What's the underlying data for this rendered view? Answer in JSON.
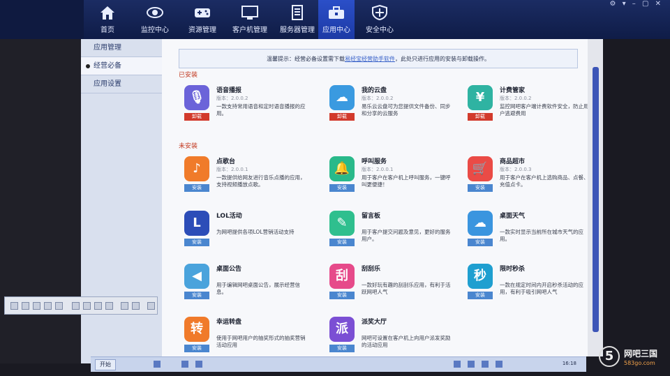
{
  "nav": {
    "items": [
      {
        "label": "首页",
        "icon": "home-icon"
      },
      {
        "label": "监控中心",
        "icon": "eye-icon"
      },
      {
        "label": "资源管理",
        "icon": "gamepad-icon"
      },
      {
        "label": "客户机管理",
        "icon": "monitor-icon"
      },
      {
        "label": "服务器管理",
        "icon": "server-icon"
      },
      {
        "label": "应用中心",
        "icon": "toolbox-icon"
      },
      {
        "label": "安全中心",
        "icon": "shield-icon"
      }
    ],
    "active": "应用中心"
  },
  "sidebar": {
    "items": [
      {
        "label": "应用管理"
      },
      {
        "label": "经营必备"
      },
      {
        "label": "应用设置"
      }
    ]
  },
  "tip": {
    "prefix": "温馨提示：经营必备设置需下载",
    "link": "易经宝经营助手软件",
    "suffix": "，此处只进行应用的安装与卸载操作。"
  },
  "sections": {
    "installed": "已安装",
    "not_installed": "未安装"
  },
  "installed_apps": [
    {
      "name": "语音播报",
      "version": "版本：2.0.0.2",
      "desc": "一款支持常用语音和定时语音播报的应用。",
      "action": "卸载",
      "icon": "microphone-icon",
      "color": "#6b63d9",
      "glyph": "🎙"
    },
    {
      "name": "我的云盘",
      "version": "版本：2.0.0.2",
      "desc": "易乐云云盘可为您提供文件备份、同步和分享的云服务",
      "action": "卸载",
      "icon": "cloud-icon",
      "color": "#3a9ae0",
      "glyph": "☁"
    },
    {
      "name": "计费管家",
      "version": "版本：2.0.0.2",
      "desc": "监控网吧客户端计费软件安全，防止用户逃避费用",
      "action": "卸载",
      "icon": "yen-shield-icon",
      "color": "#2fb3a2",
      "glyph": "¥"
    }
  ],
  "available_apps": [
    {
      "name": "点歌台",
      "version": "版本：2.0.0.1",
      "desc": "一款提供给网友进行音乐点播的应用，支持视频播放点歌。",
      "action": "安装",
      "icon": "music-note-icon",
      "color": "#f07b2a",
      "glyph": "♪"
    },
    {
      "name": "呼叫服务",
      "version": "版本：2.0.0.1",
      "desc": "用于客户在客户机上呼叫服务，一键呼叫更便捷！",
      "action": "安装",
      "icon": "bell-icon",
      "color": "#29b98a",
      "glyph": "🔔"
    },
    {
      "name": "商品超市",
      "version": "版本：2.0.0.3",
      "desc": "用于客户在客户机上选购商品、点餐、充值点卡。",
      "action": "安装",
      "icon": "cart-icon",
      "color": "#ea4b46",
      "glyph": "🛒"
    },
    {
      "name": "LOL活动",
      "version": "",
      "desc": "为网吧提供各项LOL营销活动支持",
      "action": "安装",
      "icon": "lol-icon",
      "color": "#2c4db8",
      "glyph": "L"
    },
    {
      "name": "留言板",
      "version": "",
      "desc": "用于客户提交问题及意见，更好的服务用户。",
      "action": "安装",
      "icon": "notepad-icon",
      "color": "#2fbf8e",
      "glyph": "✎"
    },
    {
      "name": "桌面天气",
      "version": "",
      "desc": "一款实时显示当前所在城市天气的应用。",
      "action": "安装",
      "icon": "weather-icon",
      "color": "#3a95df",
      "glyph": "☁"
    },
    {
      "name": "桌面公告",
      "version": "",
      "desc": "用于编辑网吧桌面公告，展示经营信息。",
      "action": "安装",
      "icon": "speaker-icon",
      "color": "#4aa3dc",
      "glyph": "◀"
    },
    {
      "name": "刮刮乐",
      "version": "",
      "desc": "一款好玩有趣的刮刮乐应用，有利于活跃网吧人气",
      "action": "安装",
      "icon": "scratch-icon",
      "color": "#e64a8a",
      "glyph": "刮"
    },
    {
      "name": "限时秒杀",
      "version": "",
      "desc": "一款在规定时间内开启秒杀活动的应用，有利于吸引网吧人气",
      "action": "安装",
      "icon": "flash-sale-icon",
      "color": "#1f9fd0",
      "glyph": "秒"
    },
    {
      "name": "幸运转盘",
      "version": "",
      "desc": "使用于网吧用户的抽奖形式的抽奖营销活动应用",
      "action": "安装",
      "icon": "wheel-icon",
      "color": "#f07a2a",
      "glyph": "转"
    },
    {
      "name": "派奖大厅",
      "version": "",
      "desc": "网吧可设置在客户机上向用户派发奖励的活动应用",
      "action": "安装",
      "icon": "award-icon",
      "color": "#7b4fd4",
      "glyph": "派"
    }
  ],
  "taskbar": {
    "start": "开始",
    "clock": "16:18"
  },
  "watermark": {
    "logo": "5",
    "name": "网吧三国",
    "url": "583go.com"
  }
}
